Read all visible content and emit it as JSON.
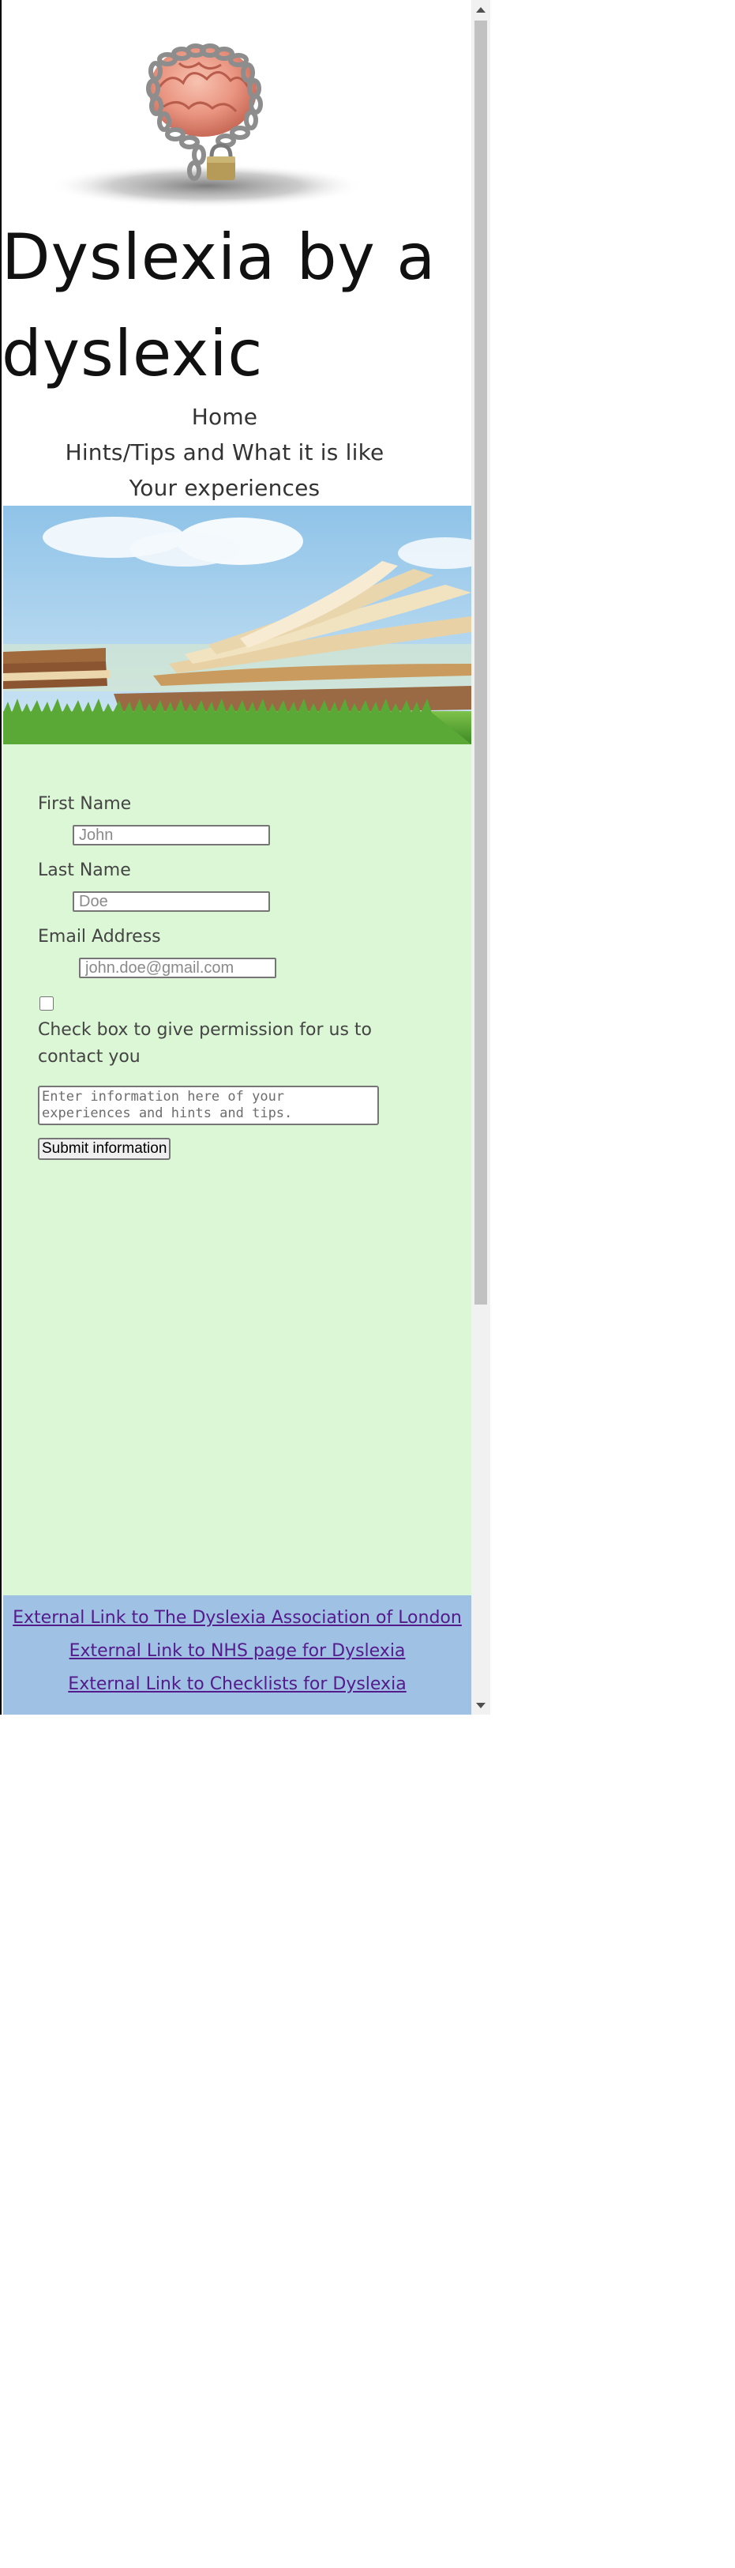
{
  "site": {
    "title": "Dyslexia by a dyslexic"
  },
  "logo": {
    "icon": "brain-chained-padlock-icon"
  },
  "nav": {
    "items": [
      {
        "label": "Home"
      },
      {
        "label": "Hints/Tips and What it is like"
      },
      {
        "label": "Your experiences"
      }
    ]
  },
  "hero": {
    "icon": "open-book-on-grass-image"
  },
  "form": {
    "first_name_label": "First Name",
    "first_name_placeholder": "John",
    "last_name_label": "Last Name",
    "last_name_placeholder": "Doe",
    "email_label": "Email Address",
    "email_placeholder": "john.doe@gmail.com",
    "permission_label": "Check box to give permission for us to contact you",
    "permission_checked": false,
    "message_placeholder": "Enter information here of your experiences and hints and tips.",
    "submit_label": "Submit information"
  },
  "footer": {
    "links": [
      {
        "label": "External Link to The Dyslexia Association of London"
      },
      {
        "label": "External Link to NHS page for Dyslexia"
      },
      {
        "label": "External Link to Checklists for Dyslexia"
      }
    ]
  },
  "colors": {
    "form_background": "#dcf7d6",
    "footer_background": "#9ec1e4",
    "visited_link": "#551a8b"
  }
}
